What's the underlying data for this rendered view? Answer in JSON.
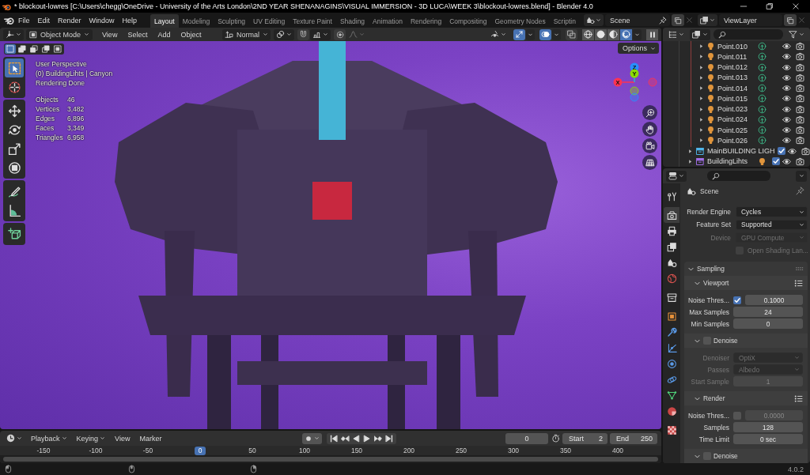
{
  "title_bar": {
    "title": "* blockout-lowres [C:\\Users\\chegg\\OneDrive - University of the Arts London\\2ND YEAR SHENANAGINS\\VISUAL IMMERSION - 3D LUCA\\WEEK 3\\blockout-lowres.blend] - Blender 4.0"
  },
  "menu_bar": {
    "menus": [
      "File",
      "Edit",
      "Render",
      "Window",
      "Help"
    ],
    "workspaces": [
      {
        "label": "Layout",
        "selected": true
      },
      {
        "label": "Modeling",
        "selected": false
      },
      {
        "label": "Sculpting",
        "selected": false
      },
      {
        "label": "UV Editing",
        "selected": false
      },
      {
        "label": "Texture Paint",
        "selected": false
      },
      {
        "label": "Shading",
        "selected": false
      },
      {
        "label": "Animation",
        "selected": false
      },
      {
        "label": "Rendering",
        "selected": false
      },
      {
        "label": "Compositing",
        "selected": false
      },
      {
        "label": "Geometry Nodes",
        "selected": false
      },
      {
        "label": "Scriptin",
        "selected": false
      }
    ],
    "scene": "Scene",
    "view_layer": "ViewLayer"
  },
  "viewport": {
    "header": {
      "mode": "Object Mode",
      "menus": [
        "View",
        "Select",
        "Add",
        "Object"
      ],
      "orientation": "Normal",
      "snap": {
        "on": false
      },
      "proportional": {
        "on": false
      },
      "toggles": [
        {
          "kind": "gizmo",
          "on": true
        },
        {
          "kind": "overlay",
          "on": true
        },
        {
          "kind": "xray",
          "on": false
        }
      ],
      "shading": [
        {
          "kind": "wireframe",
          "selected": false
        },
        {
          "kind": "solid",
          "selected": false
        },
        {
          "kind": "material",
          "selected": false
        },
        {
          "kind": "rendered",
          "selected": true
        }
      ]
    },
    "select_modes": [
      {
        "kind": "new",
        "selected": true
      },
      {
        "kind": "extend",
        "selected": false
      },
      {
        "kind": "subtract",
        "selected": false
      },
      {
        "kind": "invert",
        "selected": false
      },
      {
        "kind": "intersect",
        "selected": false
      }
    ],
    "tool_groups": [
      {
        "tools": [
          {
            "kind": "select_box",
            "selected": true
          },
          {
            "kind": "cursor",
            "selected": false
          }
        ]
      },
      {
        "tools": [
          {
            "kind": "move",
            "selected": false
          },
          {
            "kind": "rotate",
            "selected": false
          },
          {
            "kind": "scale",
            "selected": false
          },
          {
            "kind": "transform",
            "selected": false
          }
        ]
      },
      {
        "tools": [
          {
            "kind": "annotate",
            "selected": false
          },
          {
            "kind": "measure",
            "selected": false
          }
        ]
      },
      {
        "tools": [
          {
            "kind": "add_cube",
            "selected": false
          }
        ]
      }
    ],
    "info": {
      "lines": [
        "User Perspective",
        "(0) BuildingLihts | Canyon",
        "Rendering Done"
      ],
      "stats": [
        {
          "label": "Objects",
          "value": "46"
        },
        {
          "label": "Vertices",
          "value": "3,482"
        },
        {
          "label": "Edges",
          "value": "6,896"
        },
        {
          "label": "Faces",
          "value": "3,349"
        },
        {
          "label": "Triangles",
          "value": "6,958"
        }
      ]
    },
    "options": "Options",
    "gizmo": {
      "axes": [
        {
          "label": "X",
          "color": "#ff3352"
        },
        {
          "label": "Y",
          "color": "#8bdc00"
        },
        {
          "label": "Z",
          "color": "#2890ff"
        }
      ]
    }
  },
  "outliner": {
    "rows": [
      {
        "kind": "light",
        "name": "Point.010"
      },
      {
        "kind": "light",
        "name": "Point.011"
      },
      {
        "kind": "light",
        "name": "Point.012"
      },
      {
        "kind": "light",
        "name": "Point.013"
      },
      {
        "kind": "light",
        "name": "Point.014"
      },
      {
        "kind": "light",
        "name": "Point.015"
      },
      {
        "kind": "light",
        "name": "Point.023"
      },
      {
        "kind": "light",
        "name": "Point.024"
      },
      {
        "kind": "light",
        "name": "Point.025"
      },
      {
        "kind": "light",
        "name": "Point.026"
      },
      {
        "kind": "collection",
        "name": "MainBUILDING LIGH",
        "color": "#4fb4e8",
        "checked": true
      },
      {
        "kind": "collection",
        "name": "BuildingLihts",
        "color": "#a06ee8",
        "checked": true,
        "has_lights": true
      }
    ]
  },
  "properties": {
    "tabs": [
      {
        "kind": "tool",
        "selected": false
      },
      {
        "kind": "render",
        "selected": true
      },
      {
        "kind": "output",
        "selected": false
      },
      {
        "kind": "view_layer",
        "selected": false
      },
      {
        "kind": "scene",
        "selected": false
      },
      {
        "kind": "world",
        "selected": false
      },
      {
        "kind": "collection",
        "selected": false
      },
      {
        "kind": "object",
        "selected": false
      },
      {
        "kind": "modifiers",
        "selected": false
      },
      {
        "kind": "particles",
        "selected": false
      },
      {
        "kind": "physics",
        "selected": false
      },
      {
        "kind": "constraints",
        "selected": false
      },
      {
        "kind": "data",
        "selected": false
      },
      {
        "kind": "material",
        "selected": false
      },
      {
        "kind": "texture",
        "selected": false
      }
    ],
    "context": "Scene",
    "rows": [
      {
        "kind": "dropdown",
        "label": "Render Engine",
        "value": "Cycles",
        "disabled": false
      },
      {
        "kind": "dropdown",
        "label": "Feature Set",
        "value": "Supported",
        "disabled": false
      },
      {
        "kind": "dropdown",
        "label": "Device",
        "value": "GPU Compute",
        "disabled": true
      },
      {
        "kind": "checkbox",
        "label": "Open Shading Lan...",
        "checked": false,
        "disabled": true
      }
    ],
    "panels": [
      {
        "label": "Sampling",
        "expanded": true,
        "subpanels": [
          {
            "label": "Viewport",
            "expanded": true,
            "presets": true,
            "rows": [
              {
                "kind": "toggle_number",
                "label": "Noise Thres...",
                "checked": true,
                "value": "0.1000"
              },
              {
                "kind": "number",
                "label": "Max Samples",
                "value": "24",
                "disabled": false
              },
              {
                "kind": "number",
                "label": "Min Samples",
                "value": "0",
                "disabled": false
              }
            ]
          },
          {
            "label": "Denoise",
            "expanded": true,
            "checked": false,
            "rows": [
              {
                "kind": "dropdown",
                "label": "Denoiser",
                "value": "OptiX",
                "disabled": true
              },
              {
                "kind": "dropdown",
                "label": "Passes",
                "value": "Albedo",
                "disabled": true
              },
              {
                "kind": "number",
                "label": "Start Sample",
                "value": "1",
                "disabled": true
              }
            ]
          },
          {
            "label": "Render",
            "expanded": true,
            "presets": true,
            "rows": [
              {
                "kind": "toggle_number",
                "label": "Noise Thres...",
                "checked": false,
                "value": "0.0000"
              },
              {
                "kind": "number",
                "label": "Samples",
                "value": "128",
                "disabled": false
              },
              {
                "kind": "number",
                "label": "Time Limit",
                "value": "0 sec",
                "disabled": false
              }
            ]
          },
          {
            "label": "Denoise",
            "expanded": true,
            "checked": false
          }
        ]
      }
    ]
  },
  "timeline": {
    "menus": [
      {
        "label": "Playback",
        "kind": "dropdown"
      },
      {
        "label": "Keying",
        "kind": "dropdown"
      },
      {
        "label": "View",
        "kind": "plain"
      },
      {
        "label": "Marker",
        "kind": "plain"
      }
    ],
    "current_frame": "0",
    "start": {
      "label": "Start",
      "value": "2"
    },
    "end": {
      "label": "End",
      "value": "250"
    },
    "ticks": [
      {
        "label": "-150",
        "selected": false
      },
      {
        "label": "-100",
        "selected": false
      },
      {
        "label": "-50",
        "selected": false
      },
      {
        "label": "0",
        "selected": true
      },
      {
        "label": "50",
        "selected": false
      },
      {
        "label": "100",
        "selected": false
      },
      {
        "label": "150",
        "selected": false
      },
      {
        "label": "200",
        "selected": false
      },
      {
        "label": "250",
        "selected": false
      },
      {
        "label": "300",
        "selected": false
      },
      {
        "label": "350",
        "selected": false
      },
      {
        "label": "400",
        "selected": false
      }
    ]
  },
  "status_bar": {
    "version": "4.0.2"
  }
}
